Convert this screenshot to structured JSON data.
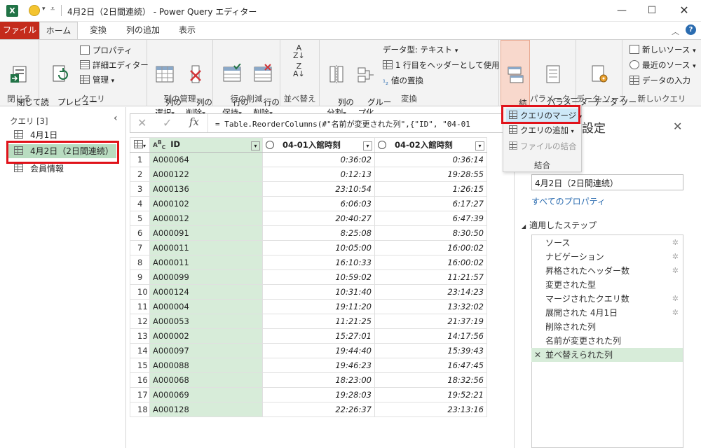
{
  "titlebar": {
    "title": "4月2日（2日間連続） - Power Query エディター",
    "app_icon": "X"
  },
  "tabs": [
    "ファイル",
    "ホーム",
    "変換",
    "列の追加",
    "表示"
  ],
  "ribbon": {
    "close": {
      "btn": "閉じて読\nみ込む",
      "group": "閉じる"
    },
    "query": {
      "preview": "プレビュー\nの更新",
      "properties": "プロパティ",
      "advanced": "詳細エディター",
      "manage": "管理",
      "group": "クエリ"
    },
    "colmgmt": {
      "select": "列の\n選択",
      "remove": "列の\n削除",
      "group": "列の管理"
    },
    "rowdel": {
      "keep": "行の\n保持",
      "remove": "行の\n削除",
      "group": "行の削減"
    },
    "sort": {
      "group": "並べ替え"
    },
    "transform": {
      "split": "列の\n分割",
      "groupby": "グルー\nプ化",
      "datatype": "データ型: テキスト",
      "header": "1 行目をヘッダーとして使用",
      "replace": "値の置換",
      "group": "変換"
    },
    "combine": {
      "btn": "結\n合",
      "group": ""
    },
    "params": {
      "btn": "パラメーター\nの管理",
      "group": "パラメーター"
    },
    "datasource": {
      "btn": "データ ソー\nス設定",
      "group": "データ ソース"
    },
    "newquery": {
      "newsrc": "新しいソース",
      "recent": "最近のソース",
      "enter": "データの入力",
      "group": "新しいクエリ"
    }
  },
  "dropdown": {
    "merge": "クエリのマージ",
    "append": "クエリの追加",
    "combine_files": "ファイルの結合",
    "label": "結合"
  },
  "queries": {
    "header": "クエリ [3]",
    "items": [
      "4月1日",
      "4月2日（2日間連続）",
      "会員情報"
    ]
  },
  "formula": "= Table.ReorderColumns(#\"名前が変更された列\",{\"ID\", \"04-01",
  "columns": [
    "ID",
    "04-01入館時刻",
    "04-02入館時刻"
  ],
  "rows": [
    [
      "1",
      "A000064",
      "0:36:02",
      "0:36:14"
    ],
    [
      "2",
      "A000122",
      "0:12:13",
      "19:28:55"
    ],
    [
      "3",
      "A000136",
      "23:10:54",
      "1:26:15"
    ],
    [
      "4",
      "A000102",
      "6:06:03",
      "6:17:27"
    ],
    [
      "5",
      "A000012",
      "20:40:27",
      "6:47:39"
    ],
    [
      "6",
      "A000091",
      "8:25:08",
      "8:30:50"
    ],
    [
      "7",
      "A000011",
      "10:05:00",
      "16:00:02"
    ],
    [
      "8",
      "A000011",
      "16:10:33",
      "16:00:02"
    ],
    [
      "9",
      "A000099",
      "10:59:02",
      "11:21:57"
    ],
    [
      "10",
      "A000124",
      "10:31:40",
      "23:14:23"
    ],
    [
      "11",
      "A000004",
      "19:11:20",
      "13:32:02"
    ],
    [
      "12",
      "A000053",
      "11:21:25",
      "21:37:19"
    ],
    [
      "13",
      "A000002",
      "15:27:01",
      "14:17:56"
    ],
    [
      "14",
      "A000097",
      "19:44:40",
      "15:39:43"
    ],
    [
      "15",
      "A000088",
      "19:46:23",
      "16:47:45"
    ],
    [
      "16",
      "A000068",
      "18:23:00",
      "18:32:56"
    ],
    [
      "17",
      "A000069",
      "19:28:03",
      "19:52:21"
    ],
    [
      "18",
      "A000128",
      "22:26:37",
      "23:13:16"
    ]
  ],
  "settings": {
    "title": "設定",
    "name": "4月2日（2日間連続）",
    "all_props": "すべてのプロパティ",
    "steps_header": "適用したステップ",
    "steps": [
      "ソース",
      "ナビゲーション",
      "昇格されたヘッダー数",
      "変更された型",
      "マージされたクエリ数",
      "展開された 4月1日",
      "削除された列",
      "名前が変更された列",
      "並べ替えられた列"
    ]
  },
  "colors": {
    "accent": "#c42b1c",
    "highlight_red": "#e0121a",
    "selected_green": "#d7ecd9",
    "excel_green": "#217346"
  }
}
